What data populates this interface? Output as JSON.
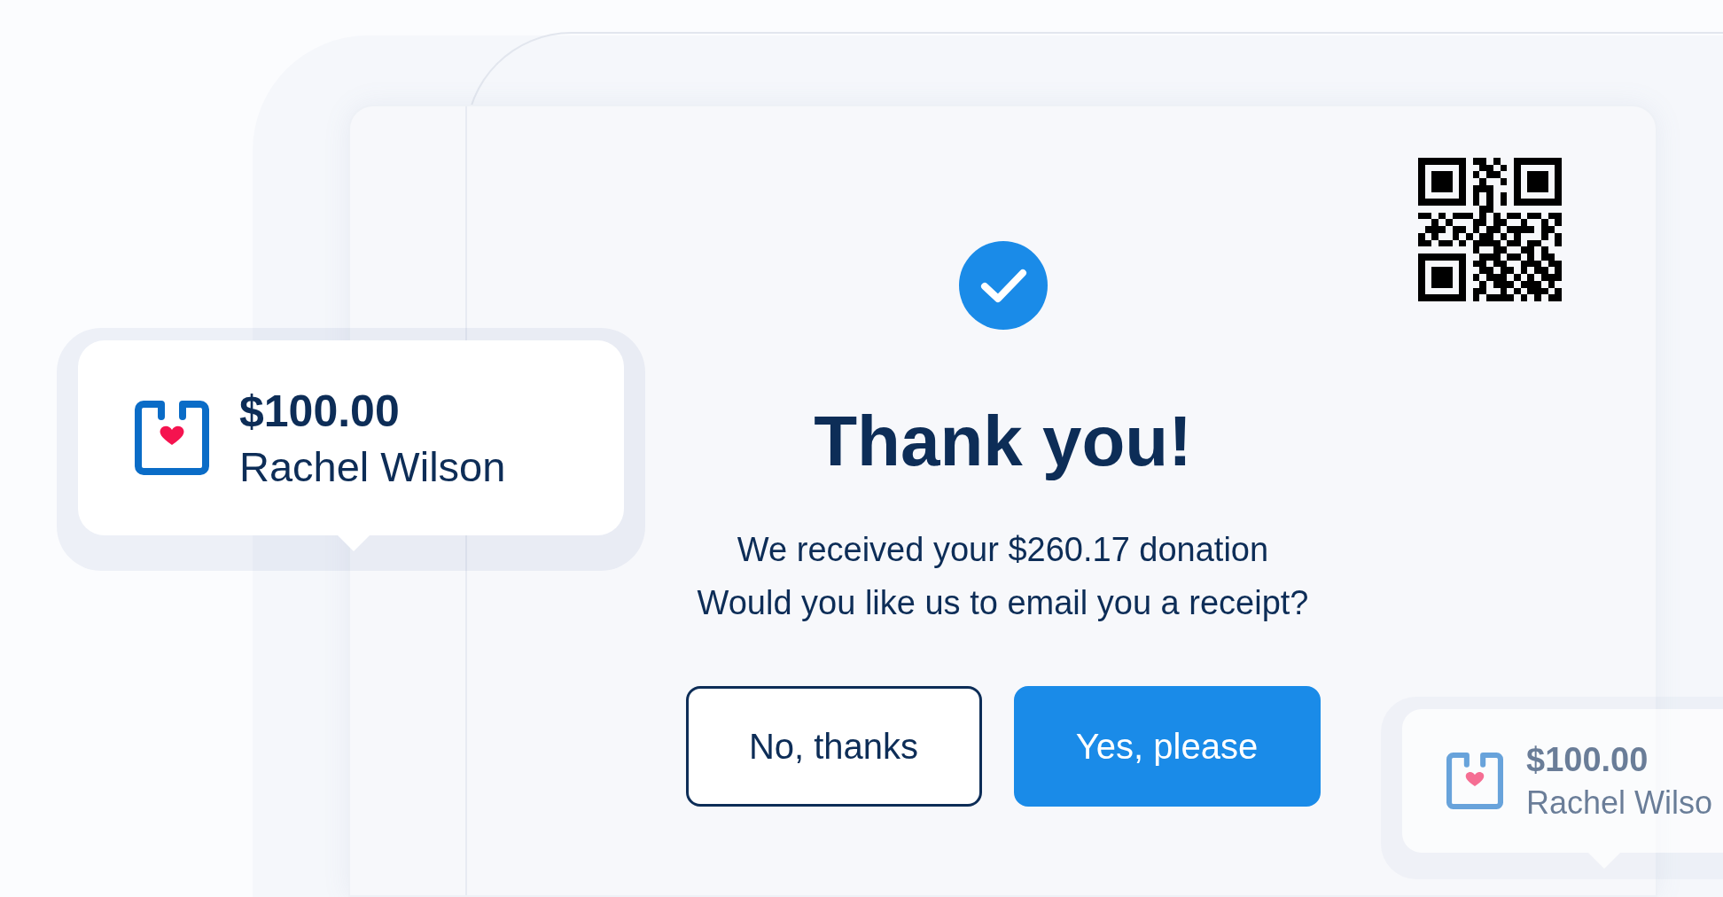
{
  "donation_card": {
    "amount": "$100.00",
    "donor": "Rachel Wilson"
  },
  "confirmation": {
    "title": "Thank you!",
    "message_lines": [
      "We received your $260.17 donation",
      "Would you like us to email you a receipt?"
    ]
  },
  "buttons": [
    {
      "label": "No, thanks",
      "kind": "secondary"
    },
    {
      "label": "Yes, please",
      "kind": "primary"
    }
  ],
  "background_card": {
    "amount": "$100.00",
    "donor": "Rachel Wilso"
  }
}
